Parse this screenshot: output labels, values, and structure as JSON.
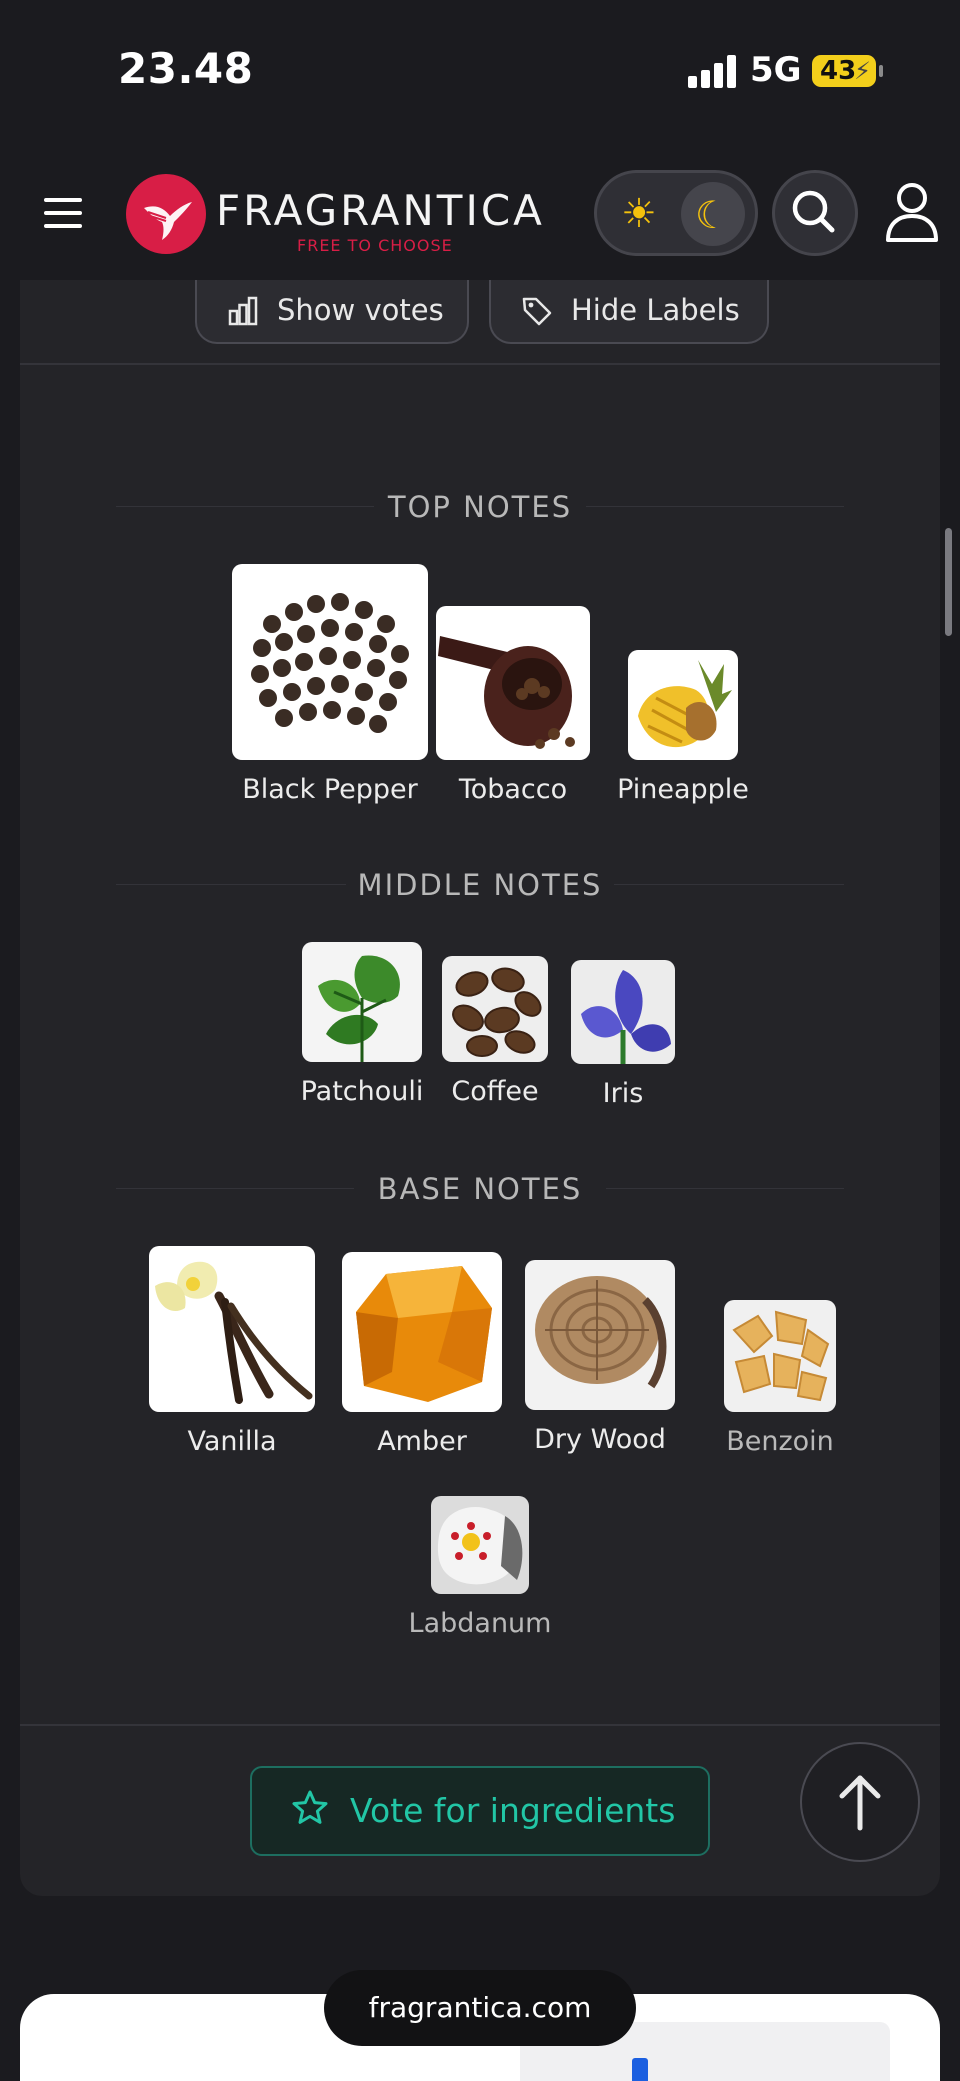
{
  "status_bar": {
    "time": "23.48",
    "network": "5G",
    "battery": "43"
  },
  "header": {
    "brand": "FRAGRANTICA",
    "tagline": "FREE TO CHOOSE"
  },
  "toolbar": {
    "show_votes": "Show votes",
    "hide_labels": "Hide Labels"
  },
  "sections": {
    "top": {
      "title": "TOP NOTES",
      "notes": [
        "Black Pepper",
        "Tobacco",
        "Pineapple"
      ]
    },
    "middle": {
      "title": "MIDDLE NOTES",
      "notes": [
        "Patchouli",
        "Coffee",
        "Iris"
      ]
    },
    "base": {
      "title": "BASE NOTES",
      "notes": [
        "Vanilla",
        "Amber",
        "Dry Wood",
        "Benzoin",
        "Labdanum"
      ]
    }
  },
  "actions": {
    "vote_label": "Vote for ingredients"
  },
  "browser": {
    "url": "fragrantica.com"
  },
  "colors": {
    "accent": "#22c6a6",
    "brand": "#d81e46",
    "background": "#1b1b1f",
    "card": "#242428"
  }
}
